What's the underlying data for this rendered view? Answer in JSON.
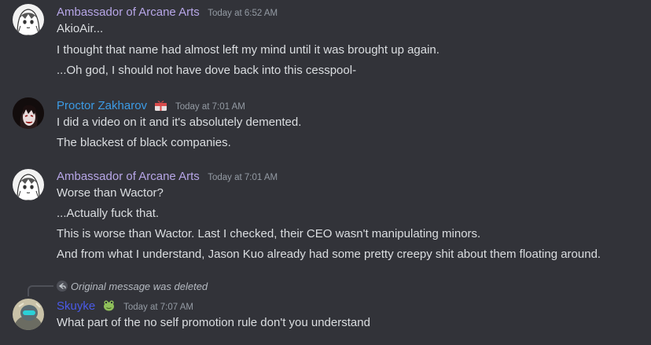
{
  "colors": {
    "background": "#323339",
    "arcane_name": "#b7a6e7",
    "proctor_name": "#3c9be5",
    "skuyke_name": "#4a5ae8",
    "timestamp": "#949ba4",
    "text": "#dbdee1"
  },
  "messages": [
    {
      "author": "Ambassador of Arcane Arts",
      "timestamp": "Today at 6:52 AM",
      "avatar_icon": "anime-girl-avatar",
      "lines": [
        "AkioAir...",
        "I thought that name had almost left my mind until it was brought up again.",
        "...Oh god, I should not have dove back into this cesspool-"
      ]
    },
    {
      "author": "Proctor Zakharov",
      "timestamp": "Today at 7:01 AM",
      "avatar_icon": "dark-haired-man-avatar",
      "role_icon": "gift-box-icon",
      "lines": [
        "I did a video on it and it's absolutely demented.",
        "The blackest of black companies."
      ]
    },
    {
      "author": "Ambassador of Arcane Arts",
      "timestamp": "Today at 7:01 AM",
      "avatar_icon": "anime-girl-avatar",
      "lines": [
        "Worse than Wactor?",
        "...Actually fuck that.",
        "This is worse than Wactor. Last I checked, their CEO wasn't manipulating minors.",
        "And from what I understand, Jason Kuo already had some pretty creepy shit about them floating around."
      ]
    },
    {
      "reply_text": "Original message was deleted",
      "author": "Skuyke",
      "timestamp": "Today at 7:07 AM",
      "avatar_icon": "helmet-character-avatar",
      "role_icon": "frog-icon",
      "lines": [
        "What part of the no self promotion rule don't you understand"
      ]
    }
  ]
}
